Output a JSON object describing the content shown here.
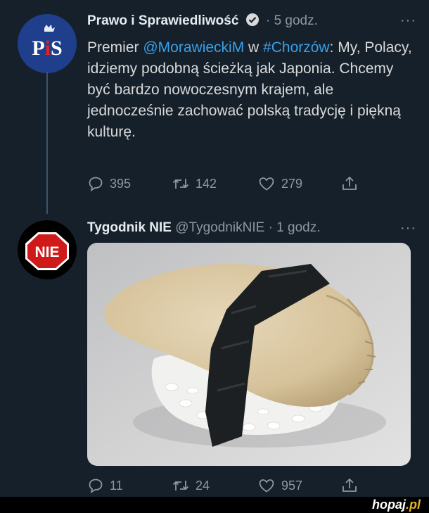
{
  "tweet1": {
    "name": "Prawo i Sprawiedliwość",
    "time": "· 5 godz.",
    "avatar_label": "PiS",
    "body": {
      "prefix": "Premier ",
      "mention": "@MorawieckiM",
      "mid": " w ",
      "hashtag": "#Chorzów",
      "rest": ": My, Polacy, idziemy podobną ścieżką jak Japonia. Chcemy być bardzo nowoczesnym krajem, ale jednocześnie zachować polską tradycję i piękną kulturę."
    },
    "replies": "395",
    "retweets": "142",
    "likes": "279"
  },
  "tweet2": {
    "name": "Tygodnik NIE",
    "handle": "@TygodnikNIE",
    "time": "· 1 godz.",
    "avatar_label": "NIE",
    "media_alt": "pierogi-sushi",
    "replies": "11",
    "retweets": "24",
    "likes": "957"
  },
  "more_glyph": "···",
  "watermark": {
    "site": "hopaj",
    "tld": ".pl"
  },
  "colors": {
    "background": "#15202b",
    "link": "#3aa0e8",
    "muted": "#8b98a5",
    "verified": "#d9d9d9"
  },
  "icons": [
    "comment-icon",
    "retweet-icon",
    "heart-icon",
    "share-icon",
    "verified-badge-icon",
    "more-icon"
  ]
}
